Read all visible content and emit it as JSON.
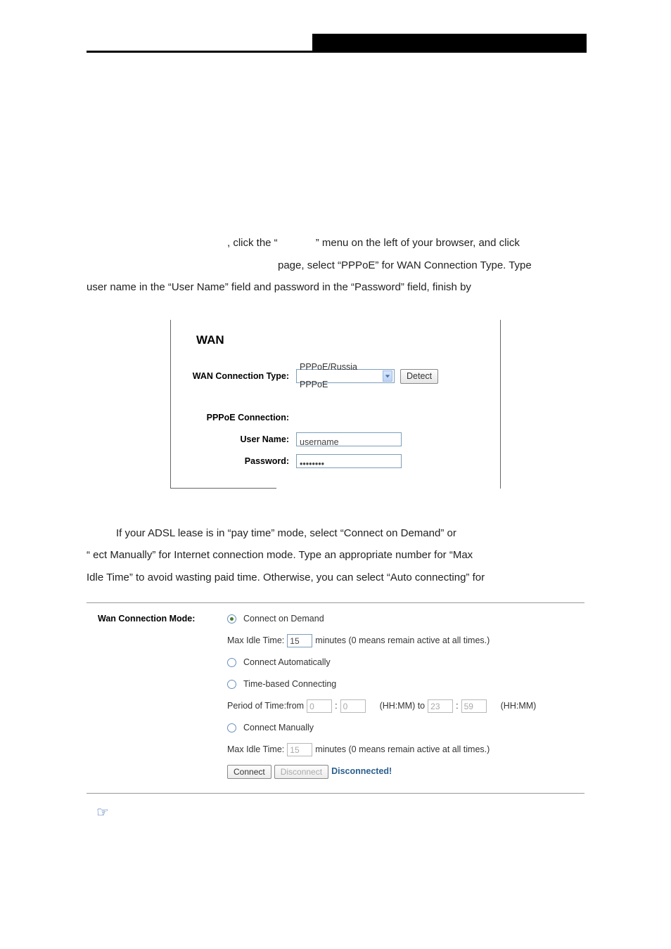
{
  "header": {
    "black_bar_text": ""
  },
  "intro": {
    "para1_pre": ", click the “",
    "para1_menu": "",
    "para1_mid": "” menu on the left of your browser, and click",
    "para1_line2": "page, select “PPPoE” for WAN Connection Type. Type",
    "para1_line3": "user name in the “User Name” field and password in the “Password” field, finish by"
  },
  "wan": {
    "title": "WAN",
    "conn_type_label": "WAN Connection Type:",
    "conn_type_value": "PPPoE/Russia PPPoE",
    "detect_btn": "Detect",
    "pppoe_heading": "PPPoE Connection:",
    "username_label": "User Name:",
    "username_value": "username",
    "password_label": "Password:",
    "password_value": "••••••••"
  },
  "figcap1": "",
  "mid": {
    "line1": "If your ADSL lease is in “pay             time” mode, select “Connect on Demand” or",
    "line2": "“      ect Manually” for Internet connection mode. Type an appropriate number for “Max",
    "line3": "Idle Time” to avoid wasting paid time. Otherwise, you can select “Auto connecting” for"
  },
  "f2": {
    "label": "Wan Connection Mode:",
    "opt1": "Connect on Demand",
    "opt1_max_label": "Max Idle Time:",
    "opt1_max_value": "15",
    "opt1_max_suffix": "minutes (0 means remain active at all times.)",
    "opt2": "Connect Automatically",
    "opt3": "Time-based Connecting",
    "opt3_period_prefix": "Period of Time:from",
    "opt3_from_h": "0",
    "opt3_from_m": "0",
    "opt3_mid": "(HH:MM) to",
    "opt3_to_h": "23",
    "opt3_to_m": "59",
    "opt3_suffix": "(HH:MM)",
    "opt4": "Connect Manually",
    "opt4_max_label": "Max Idle Time:",
    "opt4_max_value": "15",
    "opt4_max_suffix": "minutes (0 means remain active at all times.)",
    "btn_connect": "Connect",
    "btn_disconnect": "Disconnect",
    "status": "Disconnected!"
  },
  "figcap2": "",
  "note_label": ""
}
